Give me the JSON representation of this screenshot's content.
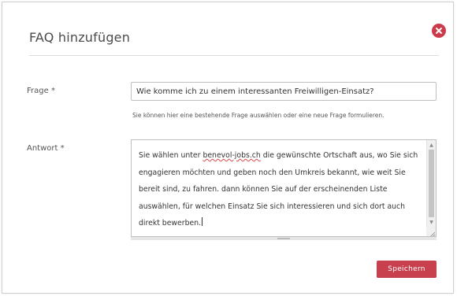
{
  "dialog": {
    "title": "FAQ hinzufügen",
    "close_icon": "close-icon"
  },
  "form": {
    "frage": {
      "label": "Frage *",
      "value": "Wie komme ich zu einem interessanten Freiwilligen-Einsatz?",
      "helper": "Sie können hier eine bestehende Frage auswählen oder eine neue Frage formulieren."
    },
    "antwort": {
      "label": "Antwort *",
      "text_before_link": "Sie wählen unter ",
      "link": "benevol-jobs.ch",
      "text_after_link": " die gewünschte Ortschaft aus, wo Sie sich engagieren möchten und geben noch den Umkreis bekannt, wie weit Sie bereit sind, zu fahren. dann können Sie auf der erscheinenden Liste auswählen, für welchen Einsatz Sie sich interessieren und sich dort auch direkt bewerben."
    }
  },
  "actions": {
    "save_label": "Speichern"
  },
  "colors": {
    "accent": "#c8404e",
    "close": "#cc3b4b"
  }
}
